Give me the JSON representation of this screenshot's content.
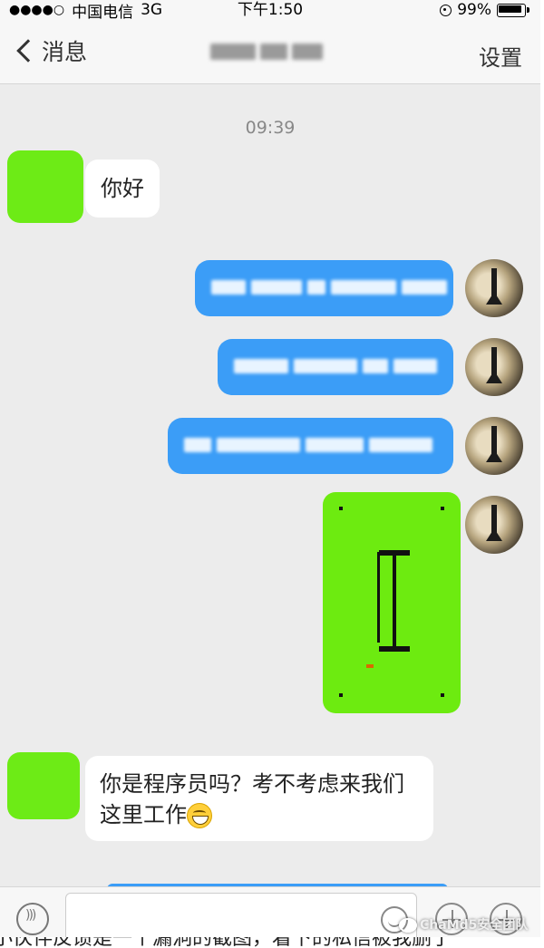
{
  "status_bar": {
    "carrier": "中国电信",
    "network": "3G",
    "time": "下午1:50",
    "battery": "99%"
  },
  "nav": {
    "back_label": "消息",
    "settings_label": "设置"
  },
  "chat": {
    "timestamp": "09:39",
    "messages": [
      {
        "side": "left",
        "text": "你好"
      },
      {
        "side": "right",
        "text": ""
      },
      {
        "side": "right",
        "text": ""
      },
      {
        "side": "right",
        "text": ""
      },
      {
        "side": "right",
        "type": "image"
      },
      {
        "side": "left",
        "text_line1": "你是程序员吗？考不考虑来我们",
        "text_line2": "这里工作"
      }
    ]
  },
  "watermark": "ChaMd5安全团队",
  "caption": "小伙伴反馈是一个漏洞的截图，着下的私信被我删了"
}
